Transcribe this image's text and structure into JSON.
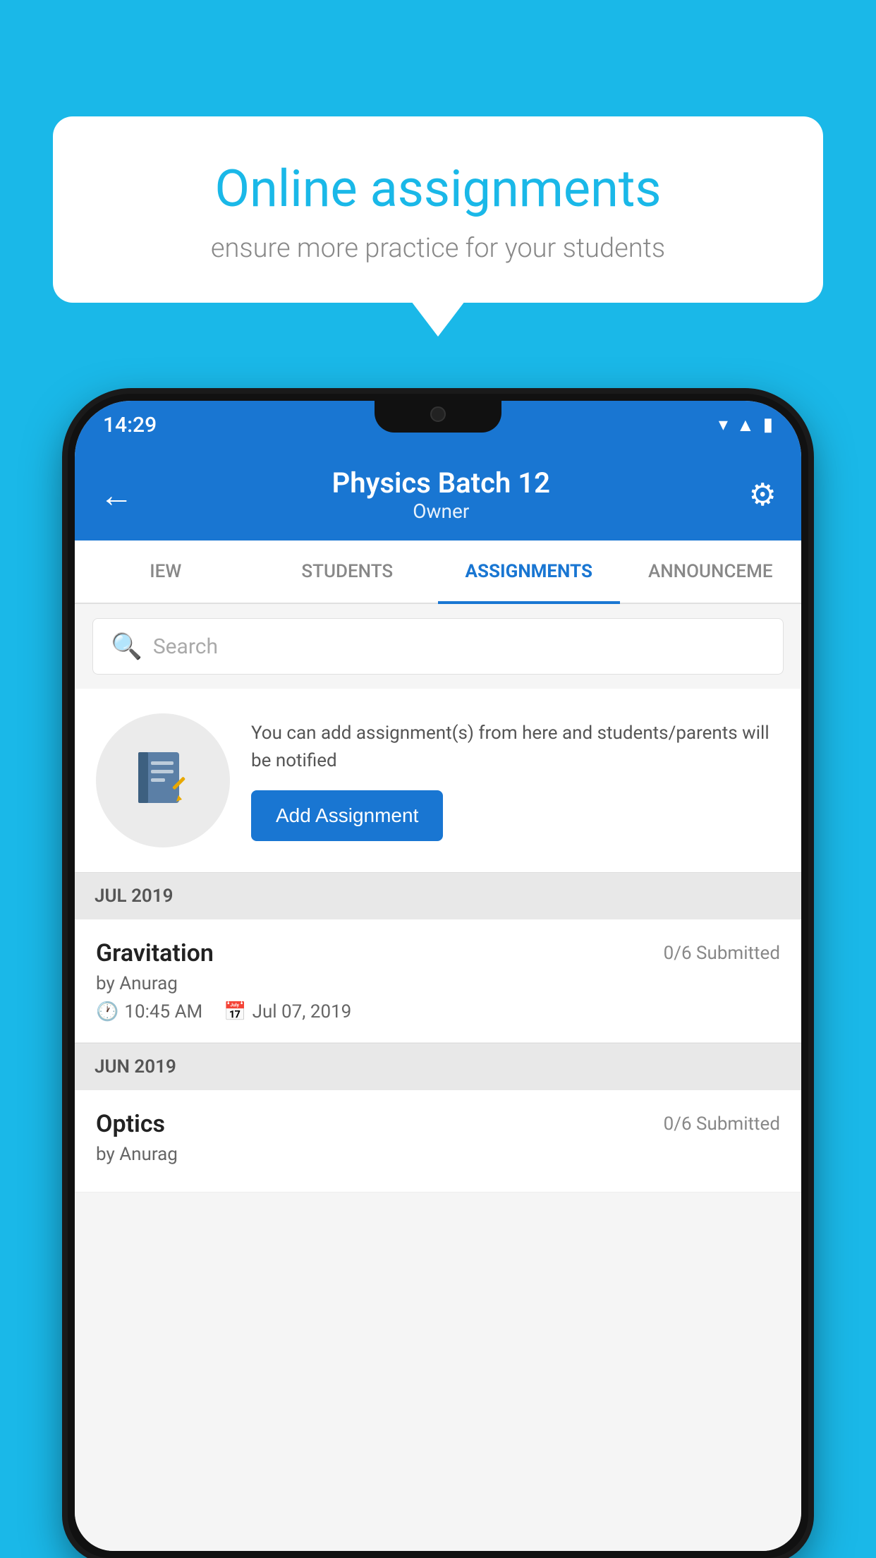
{
  "background_color": "#1ab8e8",
  "speech_bubble": {
    "title": "Online assignments",
    "subtitle": "ensure more practice for your students"
  },
  "status_bar": {
    "time": "14:29",
    "wifi_icon": "▾",
    "signal_icon": "▲",
    "battery_icon": "▮"
  },
  "app_bar": {
    "title": "Physics Batch 12",
    "subtitle": "Owner",
    "back_icon": "←",
    "settings_icon": "⚙"
  },
  "tabs": [
    {
      "label": "IEW",
      "active": false
    },
    {
      "label": "STUDENTS",
      "active": false
    },
    {
      "label": "ASSIGNMENTS",
      "active": true
    },
    {
      "label": "ANNOUNCEME",
      "active": false
    }
  ],
  "search": {
    "placeholder": "Search"
  },
  "promo": {
    "description": "You can add assignment(s) from here and students/parents will be notified",
    "button_label": "Add Assignment"
  },
  "sections": [
    {
      "month": "JUL 2019",
      "assignments": [
        {
          "name": "Gravitation",
          "submitted": "0/6 Submitted",
          "author": "by Anurag",
          "time": "10:45 AM",
          "date": "Jul 07, 2019"
        }
      ]
    },
    {
      "month": "JUN 2019",
      "assignments": [
        {
          "name": "Optics",
          "submitted": "0/6 Submitted",
          "author": "by Anurag",
          "time": "",
          "date": ""
        }
      ]
    }
  ]
}
